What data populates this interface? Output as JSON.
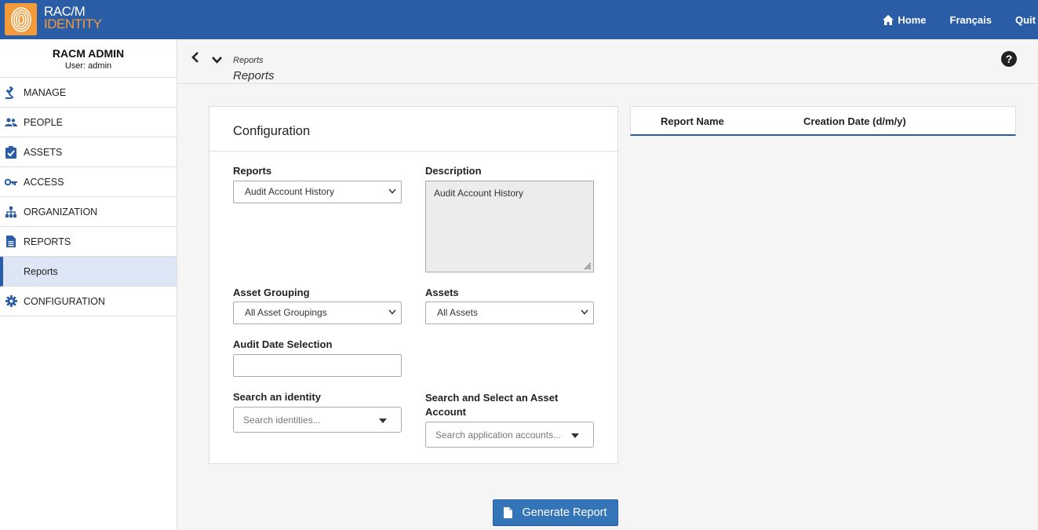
{
  "brand": {
    "line1": "RAC/M",
    "line2": "IDENTITY",
    "accent_color": "#f39a3a",
    "bar_color": "#2b5da6"
  },
  "topnav": {
    "home": "Home",
    "language": "Français",
    "quit": "Quit"
  },
  "user": {
    "name": "RACM ADMIN",
    "line": "User: admin"
  },
  "sidebar": {
    "items": [
      {
        "label": "MANAGE",
        "icon": "gavel-icon"
      },
      {
        "label": "PEOPLE",
        "icon": "people-icon"
      },
      {
        "label": "ASSETS",
        "icon": "clipboard-check-icon"
      },
      {
        "label": "ACCESS",
        "icon": "key-icon"
      },
      {
        "label": "ORGANIZATION",
        "icon": "sitemap-icon"
      },
      {
        "label": "REPORTS",
        "icon": "document-icon"
      },
      {
        "label": "Reports",
        "icon": ""
      },
      {
        "label": "CONFIGURATION",
        "icon": "gear-icon"
      }
    ]
  },
  "header": {
    "breadcrumb": "Reports",
    "title": "Reports",
    "help": "?"
  },
  "config": {
    "title": "Configuration",
    "reports_label": "Reports",
    "reports_value": "Audit Account History",
    "description_label": "Description",
    "description_value": "Audit Account History",
    "asset_grouping_label": "Asset Grouping",
    "asset_grouping_value": "All Asset Groupings",
    "assets_label": "Assets",
    "assets_value": "All Assets",
    "audit_date_label": "Audit Date Selection",
    "audit_date_value": "",
    "identity_label": "Search an identity",
    "identity_placeholder": "Search identities...",
    "asset_account_label_1": "Search and Select an Asset",
    "asset_account_label_2": "Account",
    "asset_account_placeholder": "Search application accounts..."
  },
  "report_table": {
    "columns": [
      "Report Name",
      "Creation Date (d/m/y)"
    ]
  },
  "actions": {
    "generate": "Generate Report"
  }
}
